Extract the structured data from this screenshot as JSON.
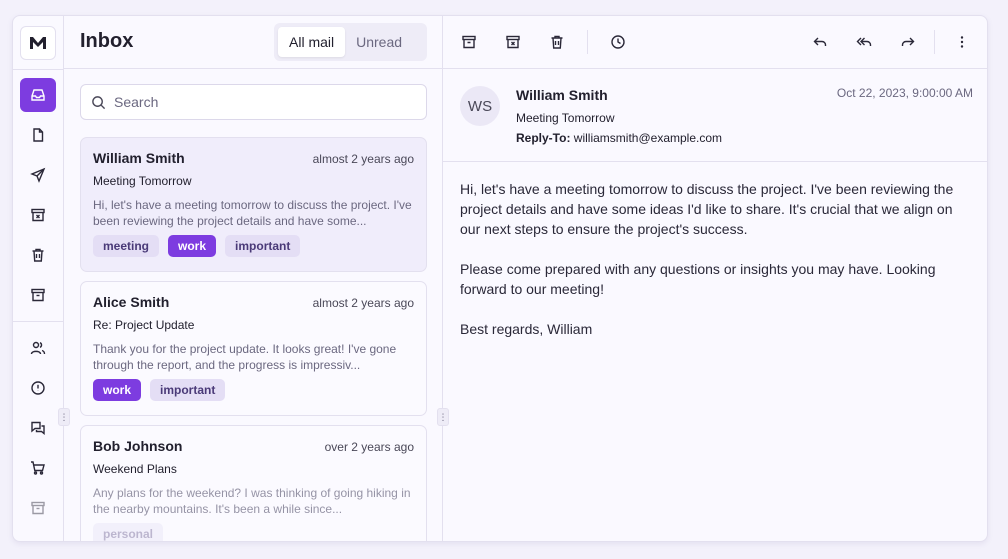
{
  "rail": {
    "logo": "M",
    "items": [
      {
        "icon": "inbox-icon",
        "active": true
      },
      {
        "icon": "file-icon",
        "active": false
      },
      {
        "icon": "send-icon",
        "active": false
      },
      {
        "icon": "archive-x-icon",
        "active": false
      },
      {
        "icon": "trash-icon",
        "active": false
      },
      {
        "icon": "archive-icon",
        "active": false
      },
      {
        "icon": "users-icon",
        "active": false
      },
      {
        "icon": "alert-circle-icon",
        "active": false
      },
      {
        "icon": "messages-icon",
        "active": false
      },
      {
        "icon": "shopping-cart-icon",
        "active": false
      },
      {
        "icon": "archive-icon",
        "active": false
      }
    ]
  },
  "list": {
    "title": "Inbox",
    "filters": [
      "All mail",
      "Unread"
    ],
    "active_filter": "All mail",
    "search_placeholder": "Search",
    "emails": [
      {
        "name": "William Smith",
        "time": "almost 2 years ago",
        "subject": "Meeting Tomorrow",
        "preview": "Hi, let's have a meeting tomorrow to discuss the project. I've been reviewing the project details and have some...",
        "tags": [
          "meeting",
          "work",
          "important"
        ],
        "selected": true
      },
      {
        "name": "Alice Smith",
        "time": "almost 2 years ago",
        "subject": "Re: Project Update",
        "preview": "Thank you for the project update. It looks great! I've gone through the report, and the progress is impressiv...",
        "tags": [
          "work",
          "important"
        ],
        "selected": false
      },
      {
        "name": "Bob Johnson",
        "time": "over 2 years ago",
        "subject": "Weekend Plans",
        "preview": "Any plans for the weekend? I was thinking of going hiking in the nearby mountains. It's been a while since...",
        "tags": [
          "personal"
        ],
        "selected": false
      }
    ]
  },
  "reader": {
    "toolbar": [
      "archive-icon",
      "archive-x-icon",
      "trash-icon",
      "clock-icon",
      "reply-icon",
      "reply-all-icon",
      "forward-icon",
      "more-vertical-icon"
    ],
    "avatar_initials": "WS",
    "from": "William Smith",
    "subject": "Meeting Tomorrow",
    "reply_to_label": "Reply-To:",
    "reply_to": "williamsmith@example.com",
    "date": "Oct 22, 2023, 9:00:00 AM",
    "body": [
      "Hi, let's have a meeting tomorrow to discuss the project. I've been reviewing the project details and have some ideas I'd like to share. It's crucial that we align on our next steps to ensure the project's success.",
      "Please come prepared with any questions or insights you may have. Looking forward to our meeting!",
      "Best regards, William"
    ]
  },
  "colors": {
    "accent": "#7d3ce0",
    "tag_bg": "#e4def5",
    "background": "#faf9ff"
  }
}
